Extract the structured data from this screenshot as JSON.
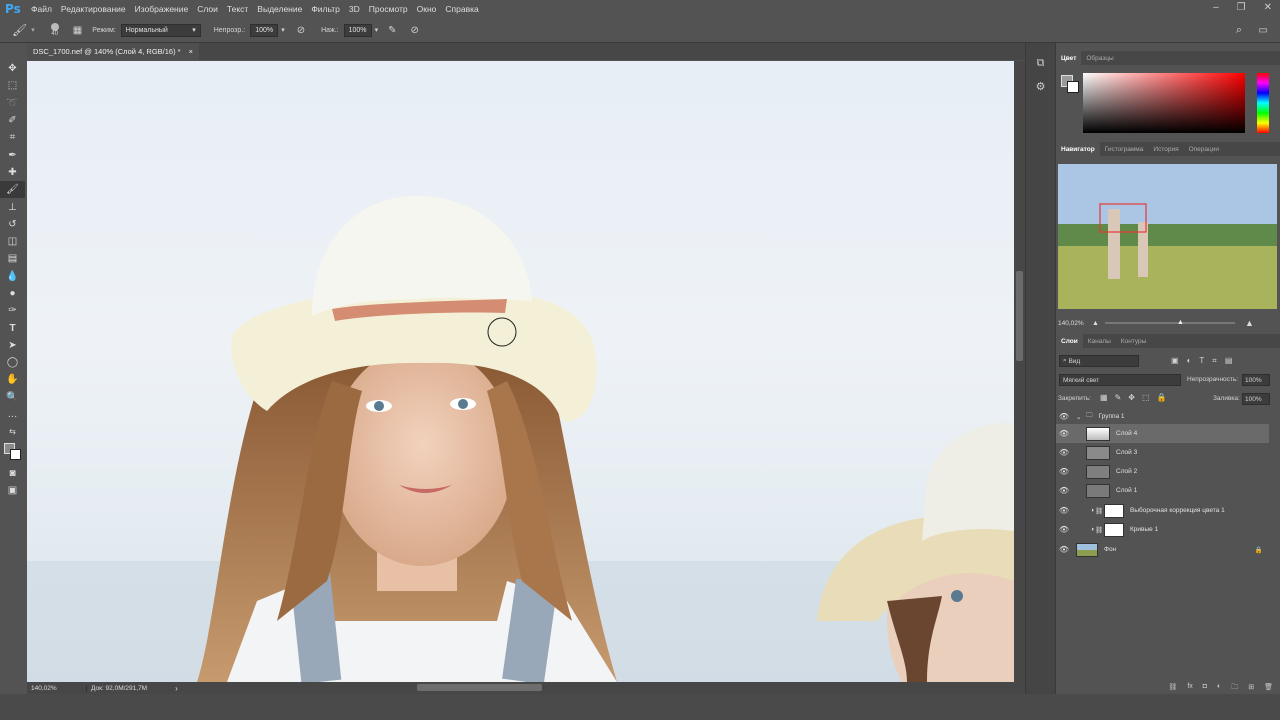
{
  "app": {
    "logo": "Ps"
  },
  "menu": [
    "Файл",
    "Редактирование",
    "Изображение",
    "Слои",
    "Текст",
    "Выделение",
    "Фильтр",
    "3D",
    "Просмотр",
    "Окно",
    "Справка"
  ],
  "options": {
    "brush_size": "40",
    "mode_label": "Режим:",
    "mode_value": "Нормальный",
    "opacity_label": "Непрозр.:",
    "opacity_value": "100%",
    "pressure_label": "Наж.:",
    "pressure_value": "100%"
  },
  "document": {
    "tab_title": "DSC_1700.nef @ 140% (Слой 4, RGB/16) *",
    "zoom": "140,02%",
    "doc_info": "Док: 92,0M/291,7M"
  },
  "color_panel": {
    "tabs": [
      "Цвет",
      "Образцы"
    ]
  },
  "navigator_panel": {
    "tabs": [
      "Навигатор",
      "Гистограмма",
      "История",
      "Операции"
    ],
    "zoom": "140,02%"
  },
  "layers_panel": {
    "tabs": [
      "Слои",
      "Каналы",
      "Контуры"
    ],
    "filter_label": "Вид",
    "blend_mode": "Мягкий свет",
    "opacity_label": "Непрозрачность:",
    "opacity_value": "100%",
    "lock_label": "Закрепить:",
    "fill_label": "Заливка:",
    "fill_value": "100%",
    "layers": [
      {
        "name": "Группа 1"
      },
      {
        "name": "Слой 4"
      },
      {
        "name": "Слой 3"
      },
      {
        "name": "Слой 2"
      },
      {
        "name": "Слой 1"
      },
      {
        "name": "Выборочная коррекция цвета 1"
      },
      {
        "name": "Кривые 1"
      },
      {
        "name": "Фон"
      }
    ]
  },
  "colors": {
    "accent": "#3fa9f5",
    "selection": "#6a6a6a"
  }
}
